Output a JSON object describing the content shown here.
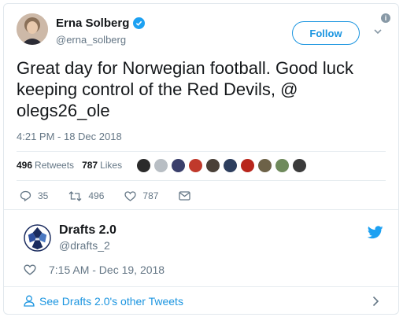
{
  "tweet": {
    "author_name": "Erna Solberg",
    "author_handle": "@erna_solberg",
    "follow_label": "Follow",
    "info_glyph": "i",
    "text": "Great day for Norwegian football. Good luck keeping control of the Red Devils, @ olegs26_ole",
    "timestamp": "4:21 PM - 18 Dec 2018",
    "retweets_count": "496",
    "retweets_label": "Retweets",
    "likes_count": "787",
    "likes_label": "Likes",
    "reply_count": "35",
    "retweet_action_count": "496",
    "like_action_count": "787",
    "liker_avatar_colors": [
      "#2b2b2b",
      "#b8bec4",
      "#3a3f6b",
      "#c0392b",
      "#4a4038",
      "#2d3e5e",
      "#b8261c",
      "#6d6248",
      "#6f8a5c",
      "#3b3b3b"
    ]
  },
  "author_card": {
    "name": "Drafts 2.0",
    "handle": "@drafts_2",
    "timestamp": "7:15 AM - Dec 19, 2018"
  },
  "footer": {
    "link_text": "See Drafts 2.0's other Tweets"
  },
  "colors": {
    "accent": "#1b95e0",
    "twitter_blue": "#1da1f2",
    "muted": "#657786"
  }
}
